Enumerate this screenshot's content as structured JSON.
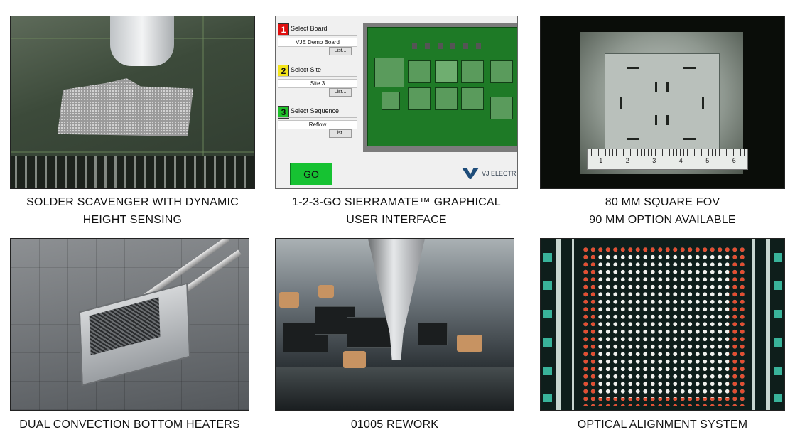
{
  "captions": {
    "p1": [
      "SOLDER SCAVENGER WITH DYNAMIC",
      "HEIGHT SENSING"
    ],
    "p2": [
      "1-2-3-GO SIERRAMATE™ GRAPHICAL",
      "USER INTERFACE"
    ],
    "p3": [
      "80 MM SQUARE FOV",
      "90 MM OPTION AVAILABLE"
    ],
    "p4": [
      "DUAL CONVECTION BOTTOM HEATERS"
    ],
    "p5": [
      "01005 REWORK"
    ],
    "p6": [
      "OPTICAL ALIGNMENT SYSTEM"
    ]
  },
  "gui": {
    "steps": [
      {
        "num": "1",
        "title": "Select Board",
        "value": "VJE Demo Board",
        "button": "List...",
        "color": "#e01010"
      },
      {
        "num": "2",
        "title": "Select Site",
        "value": "Site 3",
        "button": "List...",
        "color": "#f4e51b"
      },
      {
        "num": "3",
        "title": "Select Sequence",
        "value": "Reflow",
        "button": "List...",
        "color": "#1fbf2a"
      }
    ],
    "go_label": "GO",
    "logo_text": "VJ ELECTRON"
  },
  "ruler": {
    "numbers": [
      "1",
      "2",
      "3",
      "4",
      "5",
      "6"
    ]
  }
}
